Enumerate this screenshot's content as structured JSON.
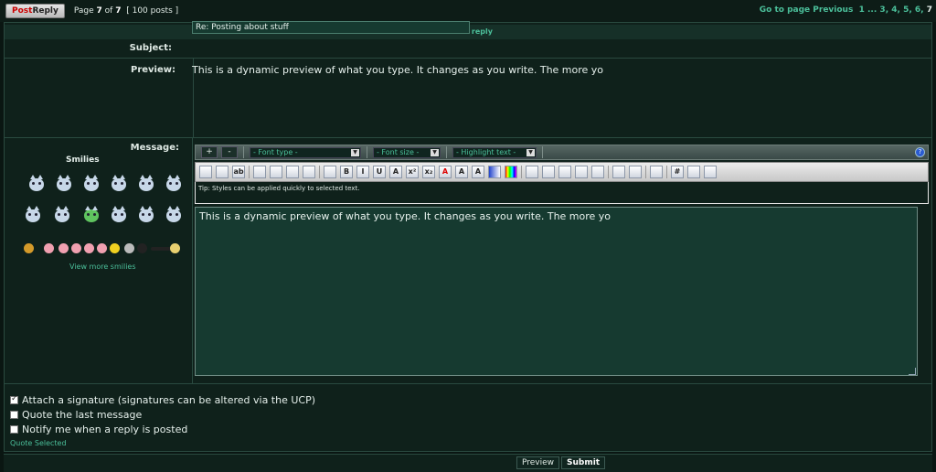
{
  "topbar": {
    "post_reply_1": "Post ",
    "post_reply_2": "Reply",
    "page_prefix": "Page ",
    "page_current": "7",
    "page_of": " of ",
    "page_total": "7",
    "posts_count": "[ 100 posts ]",
    "goto_label": "Go to page ",
    "previous": "Previous",
    "pages": [
      "1",
      "...",
      "3",
      "4",
      "5",
      "6",
      "7"
    ]
  },
  "panel": {
    "header": "Post a reply",
    "subject_label": "Subject:",
    "subject_value": "Re: Posting about stuff",
    "preview_label": "Preview:",
    "preview_text": "This is a dynamic preview of what you type. It changes as you write. The more yo",
    "message_label": "Message:"
  },
  "smilies": {
    "title": "Smilies",
    "view_more": "View more smilies"
  },
  "toolbar": {
    "plus": "+",
    "minus": "-",
    "font_type": "- Font type -",
    "font_size": "- Font size -",
    "highlight": "- Highlight text -",
    "help": "?",
    "tip": "Tip: Styles can be applied quickly to selected text.",
    "icons": [
      "copy-icon",
      "paste-icon",
      "spellcheck-icon",
      "sep",
      "bulleted-list-icon",
      "numbered-list-icon",
      "list-item-icon",
      "quote-icon",
      "sep",
      "horizontal-rule-icon",
      "bold-icon",
      "italic-icon",
      "underline-icon",
      "strikethrough-icon",
      "superscript-icon",
      "subscript-icon",
      "font-color-icon",
      "font-highlight-icon",
      "text-shadow-icon",
      "gradient-icon",
      "rainbow-icon",
      "sep",
      "align-justify-icon",
      "align-left-icon",
      "align-center-icon",
      "align-right-icon",
      "indent-icon",
      "sep",
      "flash-icon",
      "image-icon",
      "sep",
      "table-icon",
      "sep",
      "code-icon",
      "link-icon",
      "email-icon"
    ],
    "icon_glyphs": {
      "bold-icon": "B",
      "italic-icon": "I",
      "underline-icon": "U",
      "strikethrough-icon": "A",
      "superscript-icon": "x²",
      "subscript-icon": "x₂",
      "font-color-icon": "A",
      "font-highlight-icon": "A",
      "text-shadow-icon": "A",
      "spellcheck-icon": "ab",
      "code-icon": "#"
    }
  },
  "editor": {
    "text": "This is a dynamic preview of what you type. It changes as you write. The more yo"
  },
  "options": {
    "attach_signature": "Attach a signature (signatures can be altered via the UCP)",
    "quote_last": "Quote the last message",
    "notify": "Notify me when a reply is posted",
    "quote_selected": "Quote Selected"
  },
  "buttons": {
    "preview": "Preview",
    "submit": "Submit"
  },
  "colors": {
    "accent": "#4bbf9a",
    "panel_bg": "#0f211b",
    "input_bg": "#163a30"
  }
}
